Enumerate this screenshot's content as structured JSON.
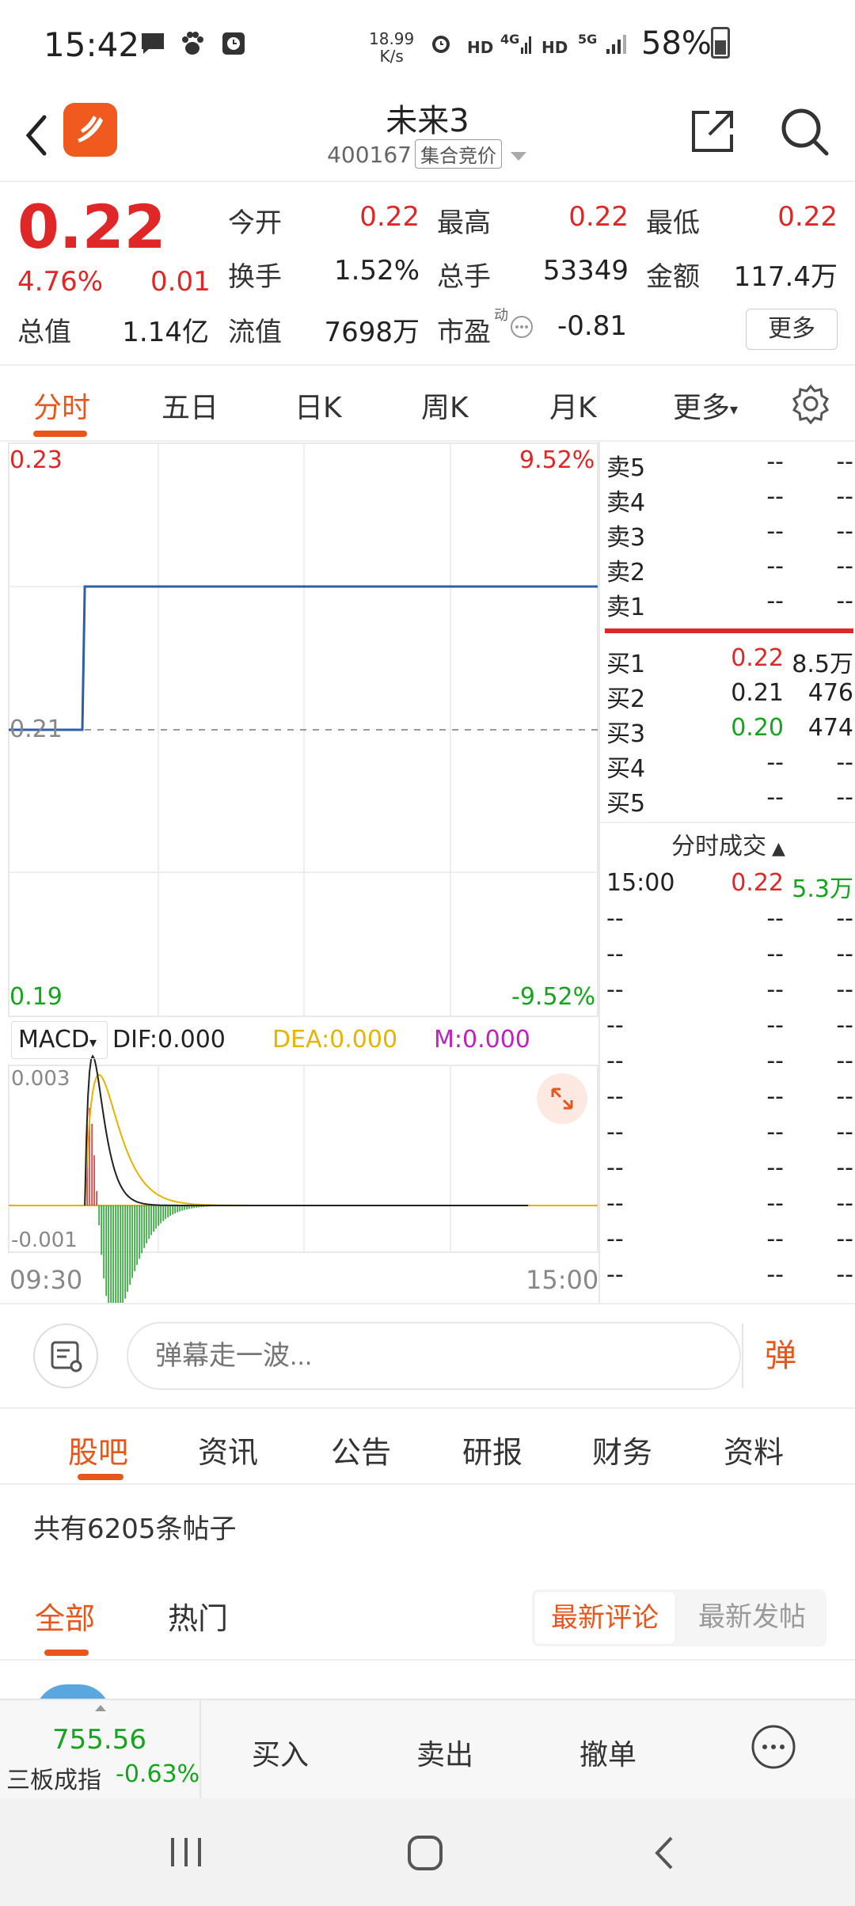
{
  "status_bar": {
    "time": "15:42",
    "net_speed_value": "18.99",
    "net_speed_unit": "K/s",
    "hd1": "HD",
    "net1": "4G",
    "hd2": "HD",
    "net2": "5G",
    "battery": "58%",
    "icons": [
      "chat-icon",
      "paw-icon",
      "clock-app-icon",
      "alarm-icon",
      "signal-icon",
      "battery-icon"
    ]
  },
  "header": {
    "title": "未来3",
    "code": "400167",
    "tag": "集合竞价",
    "accent": "#f05a1e"
  },
  "quote": {
    "price": "0.22",
    "pct": "4.76%",
    "change": "0.01",
    "open_label": "今开",
    "open": "0.22",
    "high_label": "最高",
    "high": "0.22",
    "low_label": "最低",
    "low": "0.22",
    "turnover_label": "换手",
    "turnover": "1.52%",
    "volume_label": "总手",
    "volume": "53349",
    "amount_label": "金额",
    "amount": "117.4万",
    "mktcap_label": "总值",
    "mktcap": "1.14亿",
    "float_label": "流值",
    "float": "7698万",
    "pe_label": "市盈",
    "pe_sup": "动",
    "pe": "-0.81",
    "more": "更多"
  },
  "tabs": [
    "分时",
    "五日",
    "日K",
    "周K",
    "月K",
    "更多"
  ],
  "chart": {
    "top_price": "0.23",
    "top_pct": "9.52%",
    "mid_price": "0.21",
    "bottom_price": "0.19",
    "bottom_pct": "-9.52%",
    "macd_label": "MACD",
    "dif": "DIF:0.000",
    "dea": "DEA:0.000",
    "m": "M:0.000",
    "macd_top": "0.003",
    "macd_bottom": "-0.001",
    "time_start": "09:30",
    "time_end": "15:00",
    "colors": {
      "price_line": "#2d5fa8",
      "dea": "#e8b400",
      "m": "#c020c0",
      "up": "#e02727",
      "down": "#14a51c"
    }
  },
  "chart_data": {
    "type": "line",
    "title": "",
    "xlabel": "",
    "ylabel": "",
    "x_range": [
      "09:30",
      "15:00"
    ],
    "ylim": [
      0.19,
      0.23
    ],
    "y_pct_range": [
      "-9.52%",
      "9.52%"
    ],
    "prev_close": 0.21,
    "series": [
      {
        "x": [
          "09:30",
          "10:00",
          "10:01",
          "15:00"
        ],
        "values": [
          0.21,
          0.21,
          0.22,
          0.22
        ]
      }
    ],
    "macd": {
      "ylim": [
        -0.001,
        0.003
      ],
      "dif": 0.0,
      "dea": 0.0,
      "m": 0.0
    }
  },
  "orderbook": {
    "sells": [
      {
        "label": "卖5",
        "price": "--",
        "vol": "--"
      },
      {
        "label": "卖4",
        "price": "--",
        "vol": "--"
      },
      {
        "label": "卖3",
        "price": "--",
        "vol": "--"
      },
      {
        "label": "卖2",
        "price": "--",
        "vol": "--"
      },
      {
        "label": "卖1",
        "price": "--",
        "vol": "--"
      }
    ],
    "buys": [
      {
        "label": "买1",
        "price": "0.22",
        "vol": "8.5万",
        "color": "#e02727"
      },
      {
        "label": "买2",
        "price": "0.21",
        "vol": "476",
        "color": "#222222"
      },
      {
        "label": "买3",
        "price": "0.20",
        "vol": "474",
        "color": "#14a51c"
      },
      {
        "label": "买4",
        "price": "--",
        "vol": "--",
        "color": "#222222"
      },
      {
        "label": "买5",
        "price": "--",
        "vol": "--",
        "color": "#222222"
      }
    ],
    "trades_title": "分时成交",
    "trades": [
      {
        "time": "15:00",
        "price": "0.22",
        "vol": "5.3万"
      },
      {
        "time": "--",
        "price": "--",
        "vol": "--"
      },
      {
        "time": "--",
        "price": "--",
        "vol": "--"
      },
      {
        "time": "--",
        "price": "--",
        "vol": "--"
      },
      {
        "time": "--",
        "price": "--",
        "vol": "--"
      },
      {
        "time": "--",
        "price": "--",
        "vol": "--"
      },
      {
        "time": "--",
        "price": "--",
        "vol": "--"
      },
      {
        "time": "--",
        "price": "--",
        "vol": "--"
      },
      {
        "time": "--",
        "price": "--",
        "vol": "--"
      },
      {
        "time": "--",
        "price": "--",
        "vol": "--"
      },
      {
        "time": "--",
        "price": "--",
        "vol": "--"
      },
      {
        "time": "--",
        "price": "--",
        "vol": "--"
      }
    ]
  },
  "comment": {
    "placeholder": "弹幕走一波...",
    "danmu": "弹"
  },
  "subtabs": [
    "股吧",
    "资讯",
    "公告",
    "研报",
    "财务",
    "资料"
  ],
  "posts_count": "共有6205条帖子",
  "filter": {
    "tabs": [
      "全部",
      "热门"
    ],
    "sort_a": "最新评论",
    "sort_b": "最新发帖"
  },
  "bottom": {
    "index_value": "755.56",
    "index_name": "三板成指",
    "index_change": "-0.63%",
    "buttons": [
      "买入",
      "卖出",
      "撤单"
    ]
  }
}
